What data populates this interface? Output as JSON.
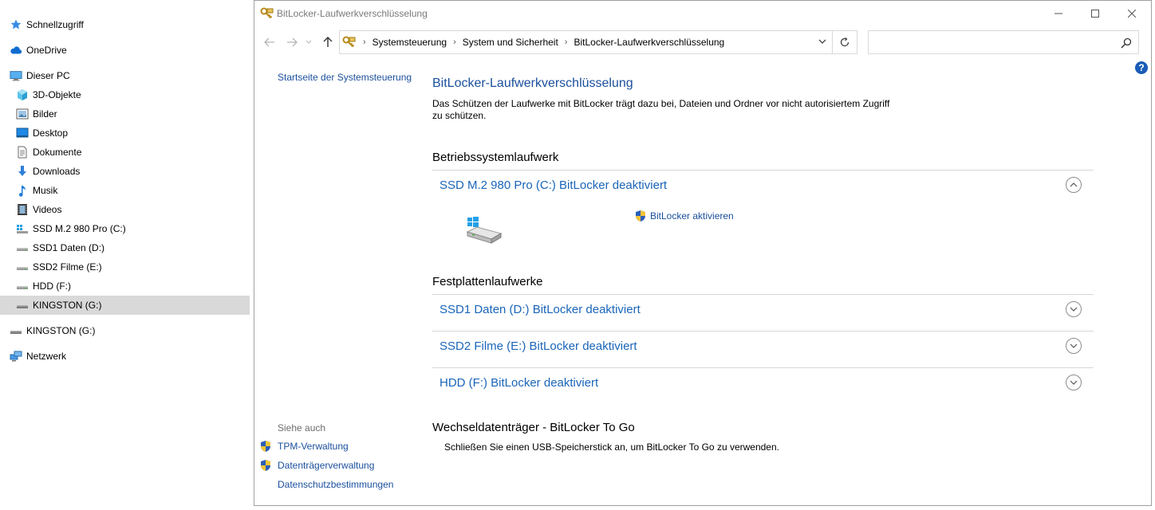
{
  "navigation": {
    "items": [
      {
        "label": "Schnellzugriff",
        "icon": "star-icon",
        "level": 0
      },
      {
        "label": "OneDrive",
        "icon": "cloud-icon",
        "level": 0
      },
      {
        "label": "Dieser PC",
        "icon": "computer-icon",
        "level": 0
      },
      {
        "label": "3D-Objekte",
        "icon": "cube-icon",
        "level": 1
      },
      {
        "label": "Bilder",
        "icon": "pictures-icon",
        "level": 1
      },
      {
        "label": "Desktop",
        "icon": "desktop-icon",
        "level": 1
      },
      {
        "label": "Dokumente",
        "icon": "document-icon",
        "level": 1
      },
      {
        "label": "Downloads",
        "icon": "download-icon",
        "level": 1
      },
      {
        "label": "Musik",
        "icon": "music-icon",
        "level": 1
      },
      {
        "label": "Videos",
        "icon": "video-icon",
        "level": 1
      },
      {
        "label": "SSD M.2 980 Pro (C:)",
        "icon": "system-drive-icon",
        "level": 1
      },
      {
        "label": "SSD1 Daten (D:)",
        "icon": "drive-icon",
        "level": 1
      },
      {
        "label": "SSD2 Filme (E:)",
        "icon": "drive-icon",
        "level": 1
      },
      {
        "label": "HDD (F:)",
        "icon": "drive-icon",
        "level": 1
      },
      {
        "label": "KINGSTON (G:)",
        "icon": "usb-drive-icon",
        "level": 1,
        "selected": true
      },
      {
        "label": "KINGSTON (G:)",
        "icon": "usb-drive-icon",
        "level": 0
      },
      {
        "label": "Netzwerk",
        "icon": "network-icon",
        "level": 0
      }
    ]
  },
  "window": {
    "title": "BitLocker-Laufwerkverschlüsselung",
    "breadcrumbs": [
      "Systemsteuerung",
      "System und Sicherheit",
      "BitLocker-Laufwerkverschlüsselung"
    ],
    "search_placeholder": ""
  },
  "sidebar": {
    "home_link": "Startseite der Systemsteuerung",
    "see_also_title": "Siehe auch",
    "links": [
      "TPM-Verwaltung",
      "Datenträgerverwaltung",
      "Datenschutzbestimmungen"
    ]
  },
  "main": {
    "title": "BitLocker-Laufwerkverschlüsselung",
    "description": "Das Schützen der Laufwerke mit BitLocker trägt dazu bei, Dateien und Ordner vor nicht autorisiertem Zugriff zu schützen.",
    "os_section": "Betriebssystemlaufwerk",
    "os_drive": "SSD M.2 980 Pro (C:) BitLocker deaktiviert",
    "activate_label": "BitLocker aktivieren",
    "fixed_section": "Festplattenlaufwerke",
    "fixed_drives": [
      "SSD1 Daten (D:) BitLocker deaktiviert",
      "SSD2 Filme (E:) BitLocker deaktiviert",
      "HDD (F:) BitLocker deaktiviert"
    ],
    "removable_section": "Wechseldatenträger - BitLocker To Go",
    "removable_text": "Schließen Sie einen USB-Speicherstick an, um BitLocker To Go zu verwenden."
  },
  "colors": {
    "link": "#1a4f9c",
    "drive_link": "#1a65b8",
    "selection": "#d9d9d9",
    "accent": "#0078d7"
  }
}
